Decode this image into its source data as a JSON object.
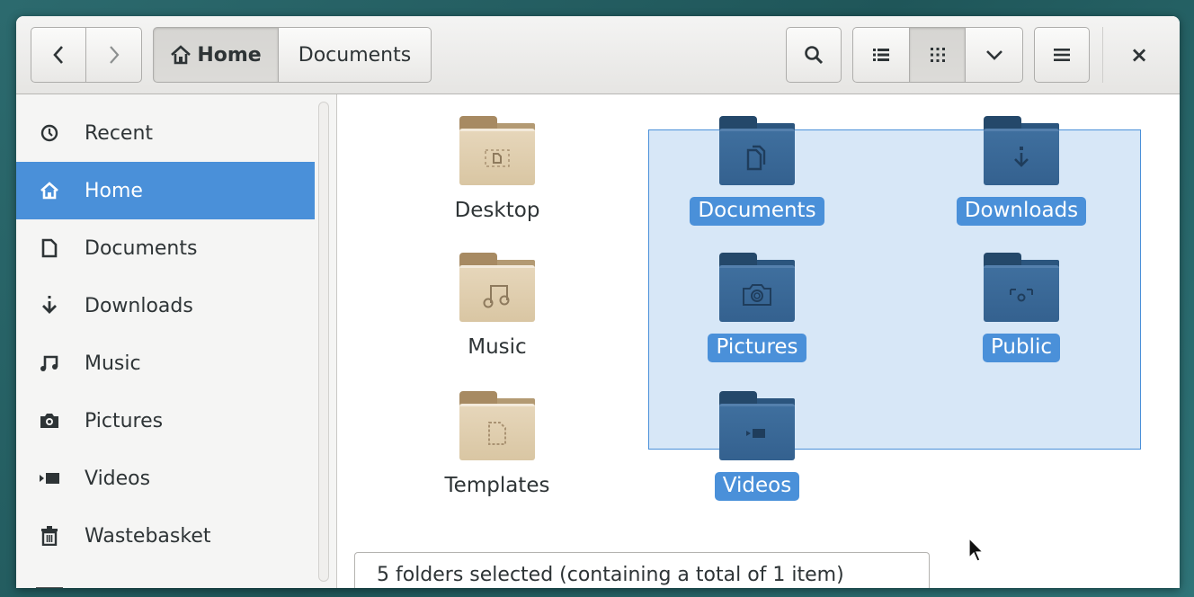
{
  "header": {
    "back_icon": "chevron-left",
    "forward_icon": "chevron-right",
    "breadcrumbs": [
      {
        "label": "Home",
        "icon": "home-icon"
      },
      {
        "label": "Documents"
      }
    ],
    "search_icon": "magnifier",
    "view_list_icon": "list",
    "view_grid_icon": "grid",
    "view_options_icon": "chevron-down",
    "menu_icon": "hamburger",
    "close_label": "×"
  },
  "sidebar": {
    "items": [
      {
        "label": "Recent",
        "icon": "clock-icon"
      },
      {
        "label": "Home",
        "icon": "home-icon",
        "active": true
      },
      {
        "label": "Documents",
        "icon": "document-icon"
      },
      {
        "label": "Downloads",
        "icon": "download-icon"
      },
      {
        "label": "Music",
        "icon": "music-icon"
      },
      {
        "label": "Pictures",
        "icon": "camera-icon"
      },
      {
        "label": "Videos",
        "icon": "video-icon"
      },
      {
        "label": "Wastebasket",
        "icon": "trash-icon"
      }
    ]
  },
  "files": [
    {
      "label": "Desktop",
      "selected": false
    },
    {
      "label": "Music",
      "selected": false
    },
    {
      "label": "Templates",
      "selected": false
    },
    {
      "label": "Documents",
      "selected": true
    },
    {
      "label": "Pictures",
      "selected": true
    },
    {
      "label": "Videos",
      "selected": true
    },
    {
      "label": "Downloads",
      "selected": true
    },
    {
      "label": "Public",
      "selected": true
    }
  ],
  "statusbar": {
    "text": "5 folders selected  (containing a total of 1 item)"
  },
  "colors": {
    "accent": "#4a90d9",
    "folder_tan": "#d9c6a3",
    "folder_blue": "#34618f"
  }
}
